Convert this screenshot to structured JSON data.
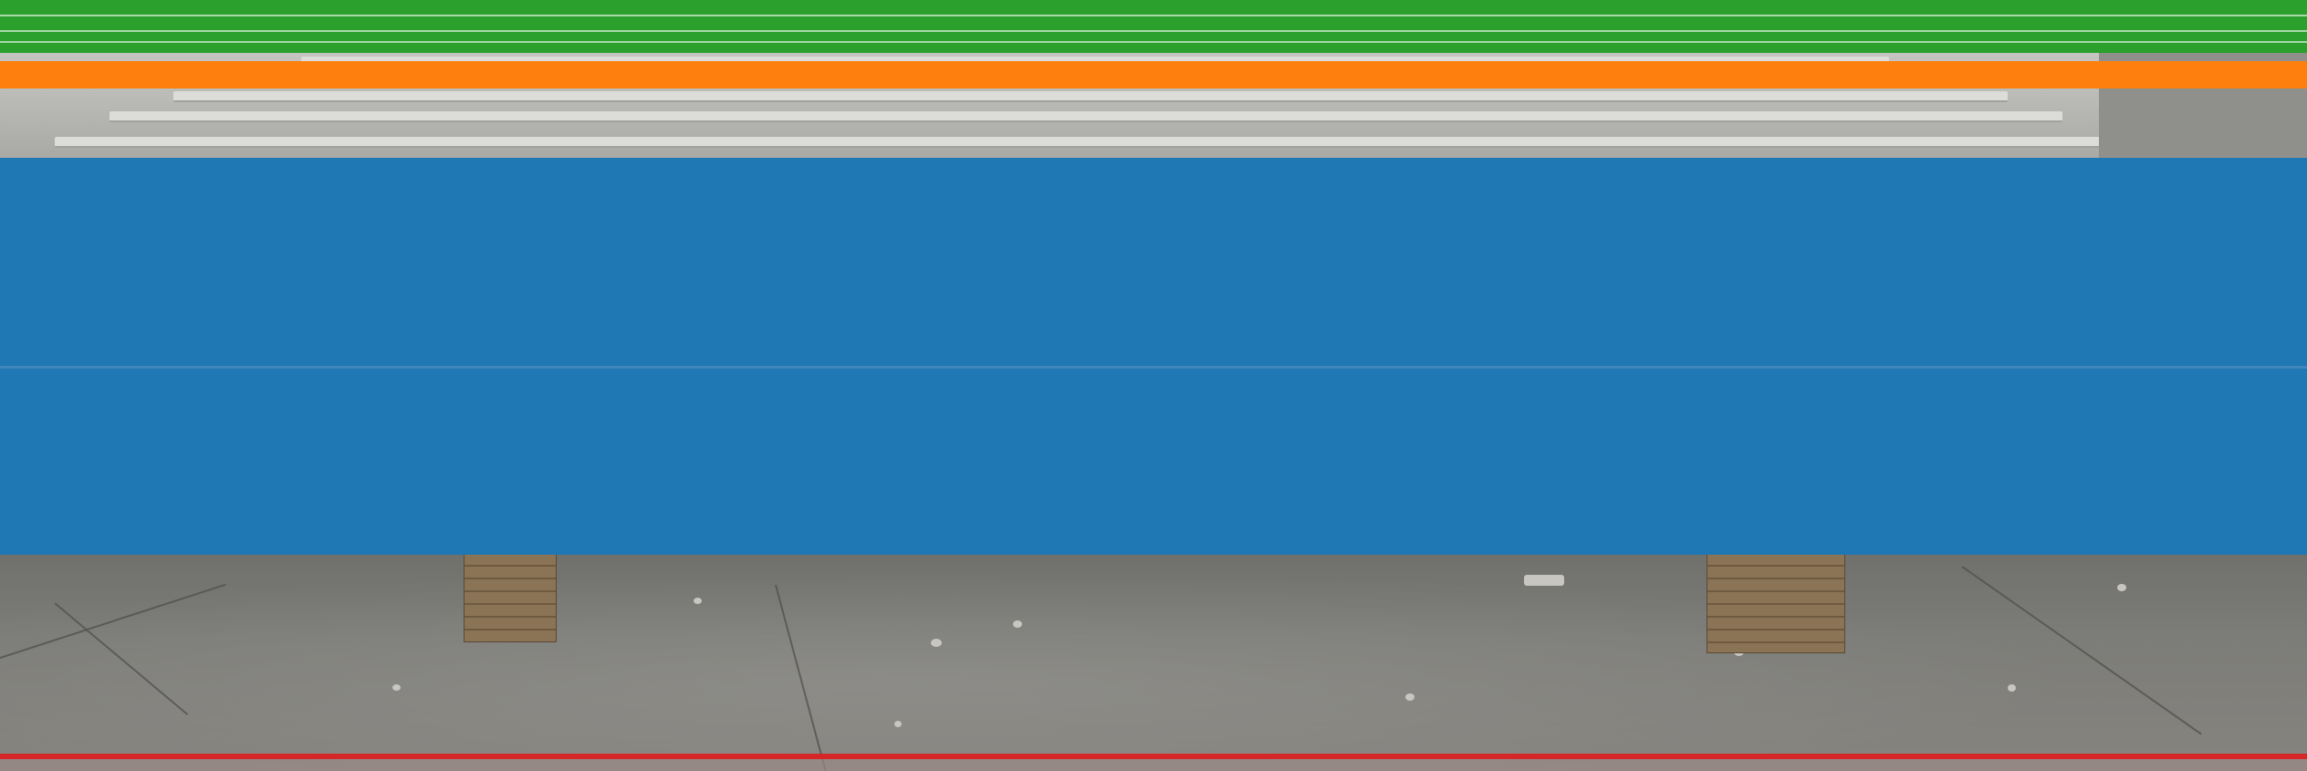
{
  "image": {
    "description_kind": "photo-with-color-overlays",
    "colors": {
      "green_band": "#2ca02c",
      "orange_band": "#ff7f0e",
      "blue_band": "#1f77b4",
      "red_band": "#d62728",
      "concrete": "#c9c9c5",
      "floor": "#7a7a76",
      "timber": "#8b7355"
    }
  }
}
